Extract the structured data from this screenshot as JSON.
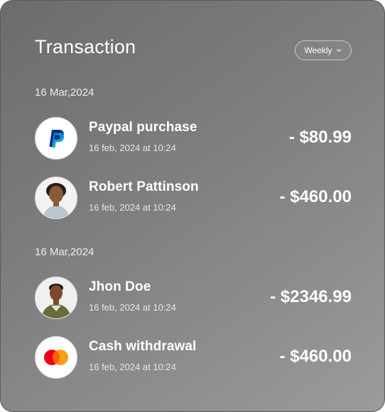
{
  "header": {
    "title": "Transaction",
    "period_label": "Weekly"
  },
  "groups": [
    {
      "date": "16 Mar,2024",
      "items": [
        {
          "name": "Paypal purchase",
          "time": "16 feb, 2024 at 10:24",
          "amount": "- $80.99",
          "icon": "paypal-logo"
        },
        {
          "name": "Robert Pattinson",
          "time": "16 feb, 2024 at 10:24",
          "amount": "- $460.00",
          "icon": "person-avatar"
        }
      ]
    },
    {
      "date": "16 Mar,2024",
      "items": [
        {
          "name": "Jhon Doe",
          "time": "16 feb, 2024 at 10:24",
          "amount": "- $2346.99",
          "icon": "person-avatar"
        },
        {
          "name": "Cash withdrawal",
          "time": "16 feb, 2024 at 10:24",
          "amount": "- $460.00",
          "icon": "mastercard-logo"
        }
      ]
    }
  ],
  "colors": {
    "paypal_dark": "#003087",
    "paypal_light": "#009cde",
    "mastercard_red": "#eb001b",
    "mastercard_orange": "#f79e1b"
  }
}
